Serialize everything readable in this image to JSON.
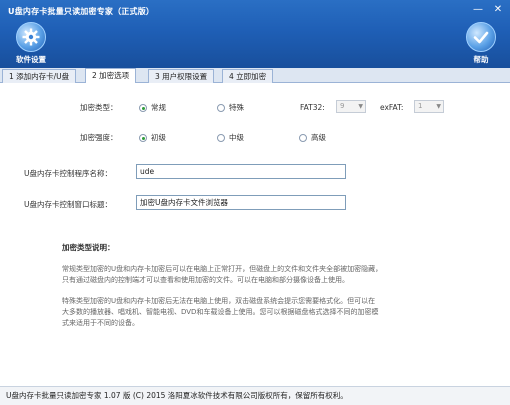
{
  "window": {
    "title": "U盘内存卡批量只读加密专家（正式版）",
    "minimize_glyph": "—",
    "close_glyph": "✕"
  },
  "toolbar": {
    "settings_label": "软件设置",
    "settings_icon": "gear-icon",
    "help_label": "帮助",
    "help_icon": "help-icon"
  },
  "tabs": [
    {
      "label": "1 添加内存卡/U盘"
    },
    {
      "label": "2 加密选项",
      "active": true
    },
    {
      "label": "3 用户权限设置"
    },
    {
      "label": "4 立即加密"
    }
  ],
  "encryption": {
    "type_label": "加密类型：",
    "type_options": [
      "常规",
      "特殊"
    ],
    "type_selected": "常规",
    "fat32_label": "FAT32:",
    "fat32_value": "9",
    "exfat_label": "exFAT:",
    "exfat_value": "1",
    "strength_label": "加密强度：",
    "strength_options": [
      "初级",
      "中级",
      "高级"
    ],
    "strength_selected": "初级"
  },
  "fields": {
    "program_name_label": "U盘内存卡控制程序名称：",
    "program_name_value": "ude",
    "window_title_label": "U盘内存卡控制窗口标题：",
    "window_title_value": "加密U盘内存卡文件浏览器"
  },
  "description": {
    "title": "加密类型说明：",
    "para1_line1": "常规类型加密的U盘和内存卡加密后可以在电脑上正常打开，但磁盘上的文件和文件夹全部被加密隐藏，",
    "para1_line2": "只有通过磁盘内的控制端才可以查看和使用加密的文件。可以在电脑和部分摄像设备上使用。",
    "para2_line1": "特殊类型加密的U盘和内存卡加密后无法在电脑上使用，双击磁盘系统会提示您需要格式化。但可以在",
    "para2_line2": "大多数的播放器、唱戏机、智能电视、DVD和车载设备上使用。您可以根据磁盘格式选择不同的加密模",
    "para2_line3": "式来适用于不同的设备。"
  },
  "status": {
    "text": "U盘内存卡批量只读加密专家 1.07 版 (C) 2015 洛阳夏冰软件技术有限公司版权所有，保留所有权利。"
  },
  "colors": {
    "titlebar": "#1f5fb6",
    "selected_radio": "#2e9b3a"
  }
}
